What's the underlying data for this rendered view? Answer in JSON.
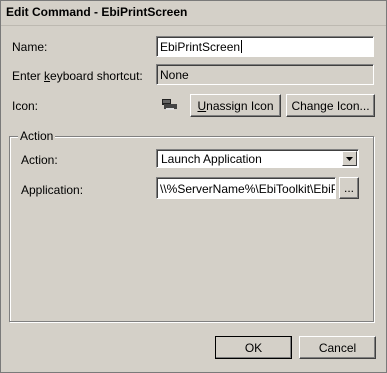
{
  "window": {
    "title": "Edit Command - EbiPrintScreen"
  },
  "form": {
    "name_label": "Name:",
    "name_value": "EbiPrintScreen",
    "shortcut_label_pre": "Enter ",
    "shortcut_label_hotkey": "k",
    "shortcut_label_post": "eyboard shortcut:",
    "shortcut_value": "None",
    "icon_label": "Icon:",
    "unassign_hotkey": "U",
    "unassign_rest": "nassign Icon",
    "change_icon_label": "Change Icon..."
  },
  "action_group": {
    "legend": "Action",
    "action_label": "Action:",
    "action_selected": "Launch Application",
    "application_label": "Application:",
    "application_value": "\\\\%ServerName%\\EbiToolkit\\EbiPrir",
    "browse_label": "..."
  },
  "buttons": {
    "ok": "OK",
    "cancel": "Cancel"
  }
}
